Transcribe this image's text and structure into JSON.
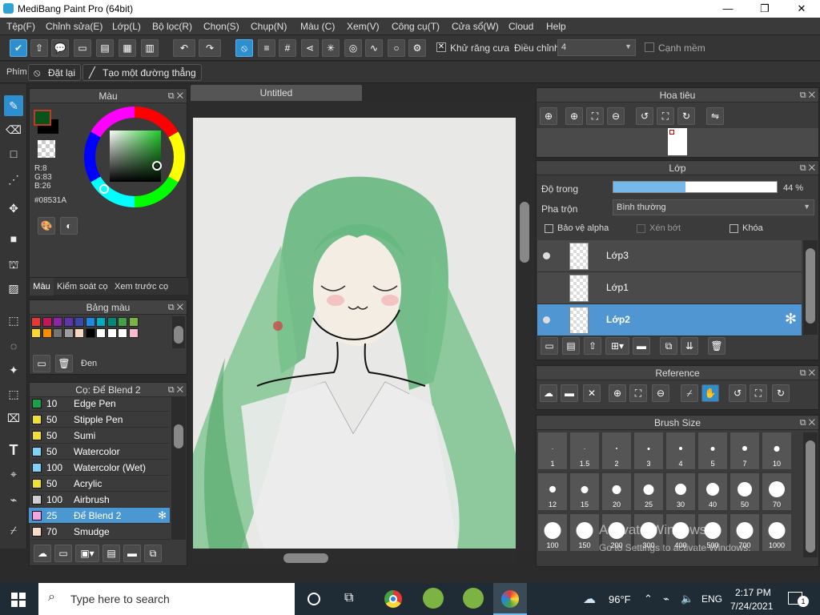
{
  "app": {
    "title": "MediBang Paint Pro (64bit)",
    "min": "—",
    "max": "❐",
    "close": "✕"
  },
  "menu": [
    "Tệp(F)",
    "Chỉnh sửa(E)",
    "Lớp(L)",
    "Bộ lọc(R)",
    "Chọn(S)",
    "Chụp(N)",
    "Màu (C)",
    "Xem(V)",
    "Công cụ(T)",
    "Cửa sổ(W)",
    "Cloud",
    "Help"
  ],
  "toolbar": {
    "antialias_label": "Khử răng cưa",
    "antialias_checked": true,
    "correction_label": "Điều chỉnh",
    "correction_value": "4",
    "soft_edge_label": "Cạnh mềm",
    "soft_edge_checked": false
  },
  "options": {
    "key_label": "Phím",
    "reset_label": "Đặt lại",
    "straight_line_label": "Tạo một đường thẳng"
  },
  "color_panel": {
    "title": "Màu",
    "r": "R:8",
    "g": "G:83",
    "b": "B:26",
    "hex": "#08531A",
    "primary_color": "#08531A",
    "tabs": [
      "Màu",
      "Kiểm soát cọ",
      "Xem trước cọ"
    ]
  },
  "palette": {
    "title": "Bảng màu",
    "name": "Đen",
    "swatches": [
      "#e53935",
      "#c2185b",
      "#8e24aa",
      "#5e35b1",
      "#3949ab",
      "#1e88e5",
      "#00acc1",
      "#00897b",
      "#43a047",
      "#7cb342",
      "#fdd835",
      "#fb8c00",
      "#757575",
      "#9e9e9e",
      "#f8d7c0",
      "#000000",
      "#ffffff",
      "#ffffff",
      "#ffffff",
      "#f8bbd0"
    ]
  },
  "brush_panel": {
    "title": "Cọ: Để Blend 2",
    "brushes": [
      {
        "size": "10",
        "name": "Edge Pen",
        "color": "#16a34a"
      },
      {
        "size": "50",
        "name": "Stipple Pen",
        "color": "#f0e130"
      },
      {
        "size": "50",
        "name": "Sumi",
        "color": "#f0e130"
      },
      {
        "size": "50",
        "name": "Watercolor",
        "color": "#7fd3f7"
      },
      {
        "size": "100",
        "name": "Watercolor (Wet)",
        "color": "#7fd3f7"
      },
      {
        "size": "50",
        "name": "Acrylic",
        "color": "#f0e130"
      },
      {
        "size": "100",
        "name": "Airbrush",
        "color": "#cfcfcf"
      },
      {
        "size": "25",
        "name": "Để Blend 2",
        "color": "#f5a3e6"
      },
      {
        "size": "70",
        "name": "Smudge",
        "color": "#f7dcc8"
      }
    ]
  },
  "document": {
    "tab": "Untitled"
  },
  "navigator": {
    "title": "Hoa tiêu"
  },
  "layers": {
    "title": "Lớp",
    "opacity_label": "Độ trong",
    "opacity_value": "44 %",
    "opacity_fraction": 0.44,
    "blend_label": "Pha trộn",
    "blend_value": "Bình thường",
    "protect_alpha": "Bảo vệ alpha",
    "clipping": "Xén bớt",
    "lock": "Khóa",
    "items": [
      {
        "name": "Lớp3",
        "visible": true,
        "selected": false
      },
      {
        "name": "Lớp1",
        "visible": false,
        "selected": false
      },
      {
        "name": "Lớp2",
        "visible": true,
        "selected": true
      }
    ]
  },
  "reference": {
    "title": "Reference"
  },
  "brush_size": {
    "title": "Brush Size",
    "sizes": [
      "1",
      "1.5",
      "2",
      "3",
      "4",
      "5",
      "7",
      "10",
      "12",
      "15",
      "20",
      "25",
      "30",
      "40",
      "50",
      "70",
      "100",
      "150",
      "200",
      "300",
      "400",
      "500",
      "700",
      "1000"
    ]
  },
  "watermark": {
    "line1": "Activate Windows",
    "line2": "Go to Settings to activate Windows."
  },
  "taskbar": {
    "search_placeholder": "Type here to search",
    "weather": "96°F",
    "lang": "ENG",
    "time": "2:17 PM",
    "date": "7/24/2021",
    "notif_count": "1"
  }
}
